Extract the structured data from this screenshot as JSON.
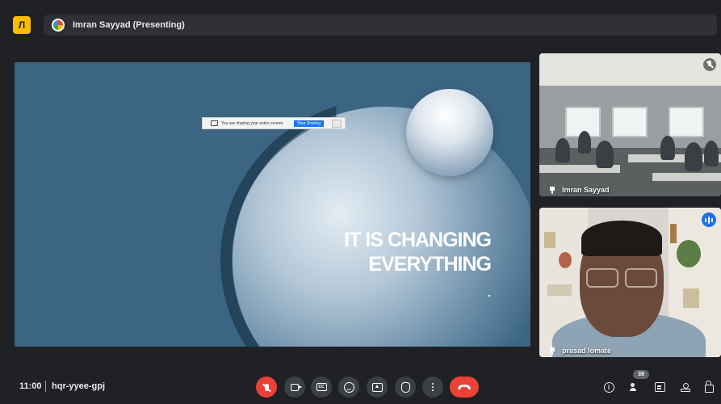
{
  "header": {
    "app_logo_text": "Л",
    "presenter_label": "Imran Sayyad (Presenting)"
  },
  "share_banner": {
    "message": "You are sharing your entire screen.",
    "stop_label": "Stop Sharing"
  },
  "slide": {
    "title_line1": "IT IS CHANGING",
    "title_line2": "EVERYTHING",
    "background_color": "#3c6584"
  },
  "participants": [
    {
      "name": "Imran Sayyad",
      "mic": "muted"
    },
    {
      "name": "prasad lomate",
      "mic": "speaking"
    }
  ],
  "footer": {
    "time": "11:00",
    "meeting_code": "hqr-yyee-gpj",
    "people_count": "39"
  },
  "controls": {
    "center": [
      "mic-off-icon",
      "camera-icon",
      "captions-icon",
      "emoji-icon",
      "present-icon",
      "raise-hand-icon",
      "more-options-icon",
      "end-call-icon"
    ],
    "right": [
      "info-icon",
      "people-icon",
      "chat-icon",
      "activities-icon",
      "host-controls-icon"
    ],
    "captions_glyph": "CC"
  },
  "colors": {
    "end_call": "#ea4335",
    "accent": "#1a73e8",
    "background": "#202124"
  }
}
